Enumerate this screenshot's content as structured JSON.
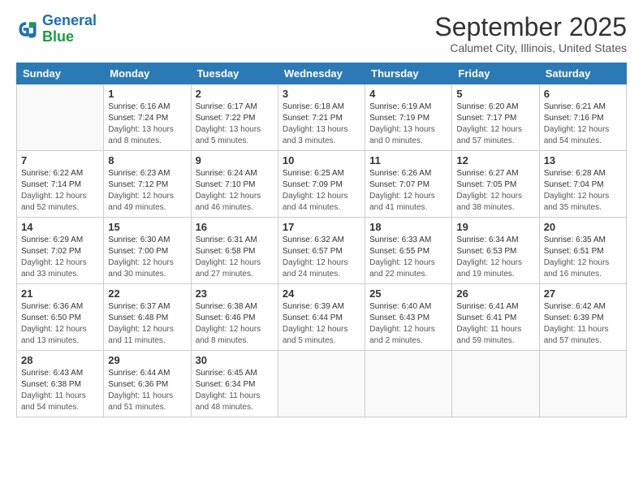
{
  "logo": {
    "line1": "General",
    "line2": "Blue"
  },
  "header": {
    "month": "September 2025",
    "location": "Calumet City, Illinois, United States"
  },
  "days_of_week": [
    "Sunday",
    "Monday",
    "Tuesday",
    "Wednesday",
    "Thursday",
    "Friday",
    "Saturday"
  ],
  "weeks": [
    [
      {
        "day": "",
        "sunrise": "",
        "sunset": "",
        "daylight": ""
      },
      {
        "day": "1",
        "sunrise": "Sunrise: 6:16 AM",
        "sunset": "Sunset: 7:24 PM",
        "daylight": "Daylight: 13 hours and 8 minutes."
      },
      {
        "day": "2",
        "sunrise": "Sunrise: 6:17 AM",
        "sunset": "Sunset: 7:22 PM",
        "daylight": "Daylight: 13 hours and 5 minutes."
      },
      {
        "day": "3",
        "sunrise": "Sunrise: 6:18 AM",
        "sunset": "Sunset: 7:21 PM",
        "daylight": "Daylight: 13 hours and 3 minutes."
      },
      {
        "day": "4",
        "sunrise": "Sunrise: 6:19 AM",
        "sunset": "Sunset: 7:19 PM",
        "daylight": "Daylight: 13 hours and 0 minutes."
      },
      {
        "day": "5",
        "sunrise": "Sunrise: 6:20 AM",
        "sunset": "Sunset: 7:17 PM",
        "daylight": "Daylight: 12 hours and 57 minutes."
      },
      {
        "day": "6",
        "sunrise": "Sunrise: 6:21 AM",
        "sunset": "Sunset: 7:16 PM",
        "daylight": "Daylight: 12 hours and 54 minutes."
      }
    ],
    [
      {
        "day": "7",
        "sunrise": "Sunrise: 6:22 AM",
        "sunset": "Sunset: 7:14 PM",
        "daylight": "Daylight: 12 hours and 52 minutes."
      },
      {
        "day": "8",
        "sunrise": "Sunrise: 6:23 AM",
        "sunset": "Sunset: 7:12 PM",
        "daylight": "Daylight: 12 hours and 49 minutes."
      },
      {
        "day": "9",
        "sunrise": "Sunrise: 6:24 AM",
        "sunset": "Sunset: 7:10 PM",
        "daylight": "Daylight: 12 hours and 46 minutes."
      },
      {
        "day": "10",
        "sunrise": "Sunrise: 6:25 AM",
        "sunset": "Sunset: 7:09 PM",
        "daylight": "Daylight: 12 hours and 44 minutes."
      },
      {
        "day": "11",
        "sunrise": "Sunrise: 6:26 AM",
        "sunset": "Sunset: 7:07 PM",
        "daylight": "Daylight: 12 hours and 41 minutes."
      },
      {
        "day": "12",
        "sunrise": "Sunrise: 6:27 AM",
        "sunset": "Sunset: 7:05 PM",
        "daylight": "Daylight: 12 hours and 38 minutes."
      },
      {
        "day": "13",
        "sunrise": "Sunrise: 6:28 AM",
        "sunset": "Sunset: 7:04 PM",
        "daylight": "Daylight: 12 hours and 35 minutes."
      }
    ],
    [
      {
        "day": "14",
        "sunrise": "Sunrise: 6:29 AM",
        "sunset": "Sunset: 7:02 PM",
        "daylight": "Daylight: 12 hours and 33 minutes."
      },
      {
        "day": "15",
        "sunrise": "Sunrise: 6:30 AM",
        "sunset": "Sunset: 7:00 PM",
        "daylight": "Daylight: 12 hours and 30 minutes."
      },
      {
        "day": "16",
        "sunrise": "Sunrise: 6:31 AM",
        "sunset": "Sunset: 6:58 PM",
        "daylight": "Daylight: 12 hours and 27 minutes."
      },
      {
        "day": "17",
        "sunrise": "Sunrise: 6:32 AM",
        "sunset": "Sunset: 6:57 PM",
        "daylight": "Daylight: 12 hours and 24 minutes."
      },
      {
        "day": "18",
        "sunrise": "Sunrise: 6:33 AM",
        "sunset": "Sunset: 6:55 PM",
        "daylight": "Daylight: 12 hours and 22 minutes."
      },
      {
        "day": "19",
        "sunrise": "Sunrise: 6:34 AM",
        "sunset": "Sunset: 6:53 PM",
        "daylight": "Daylight: 12 hours and 19 minutes."
      },
      {
        "day": "20",
        "sunrise": "Sunrise: 6:35 AM",
        "sunset": "Sunset: 6:51 PM",
        "daylight": "Daylight: 12 hours and 16 minutes."
      }
    ],
    [
      {
        "day": "21",
        "sunrise": "Sunrise: 6:36 AM",
        "sunset": "Sunset: 6:50 PM",
        "daylight": "Daylight: 12 hours and 13 minutes."
      },
      {
        "day": "22",
        "sunrise": "Sunrise: 6:37 AM",
        "sunset": "Sunset: 6:48 PM",
        "daylight": "Daylight: 12 hours and 11 minutes."
      },
      {
        "day": "23",
        "sunrise": "Sunrise: 6:38 AM",
        "sunset": "Sunset: 6:46 PM",
        "daylight": "Daylight: 12 hours and 8 minutes."
      },
      {
        "day": "24",
        "sunrise": "Sunrise: 6:39 AM",
        "sunset": "Sunset: 6:44 PM",
        "daylight": "Daylight: 12 hours and 5 minutes."
      },
      {
        "day": "25",
        "sunrise": "Sunrise: 6:40 AM",
        "sunset": "Sunset: 6:43 PM",
        "daylight": "Daylight: 12 hours and 2 minutes."
      },
      {
        "day": "26",
        "sunrise": "Sunrise: 6:41 AM",
        "sunset": "Sunset: 6:41 PM",
        "daylight": "Daylight: 11 hours and 59 minutes."
      },
      {
        "day": "27",
        "sunrise": "Sunrise: 6:42 AM",
        "sunset": "Sunset: 6:39 PM",
        "daylight": "Daylight: 11 hours and 57 minutes."
      }
    ],
    [
      {
        "day": "28",
        "sunrise": "Sunrise: 6:43 AM",
        "sunset": "Sunset: 6:38 PM",
        "daylight": "Daylight: 11 hours and 54 minutes."
      },
      {
        "day": "29",
        "sunrise": "Sunrise: 6:44 AM",
        "sunset": "Sunset: 6:36 PM",
        "daylight": "Daylight: 11 hours and 51 minutes."
      },
      {
        "day": "30",
        "sunrise": "Sunrise: 6:45 AM",
        "sunset": "Sunset: 6:34 PM",
        "daylight": "Daylight: 11 hours and 48 minutes."
      },
      {
        "day": "",
        "sunrise": "",
        "sunset": "",
        "daylight": ""
      },
      {
        "day": "",
        "sunrise": "",
        "sunset": "",
        "daylight": ""
      },
      {
        "day": "",
        "sunrise": "",
        "sunset": "",
        "daylight": ""
      },
      {
        "day": "",
        "sunrise": "",
        "sunset": "",
        "daylight": ""
      }
    ]
  ]
}
